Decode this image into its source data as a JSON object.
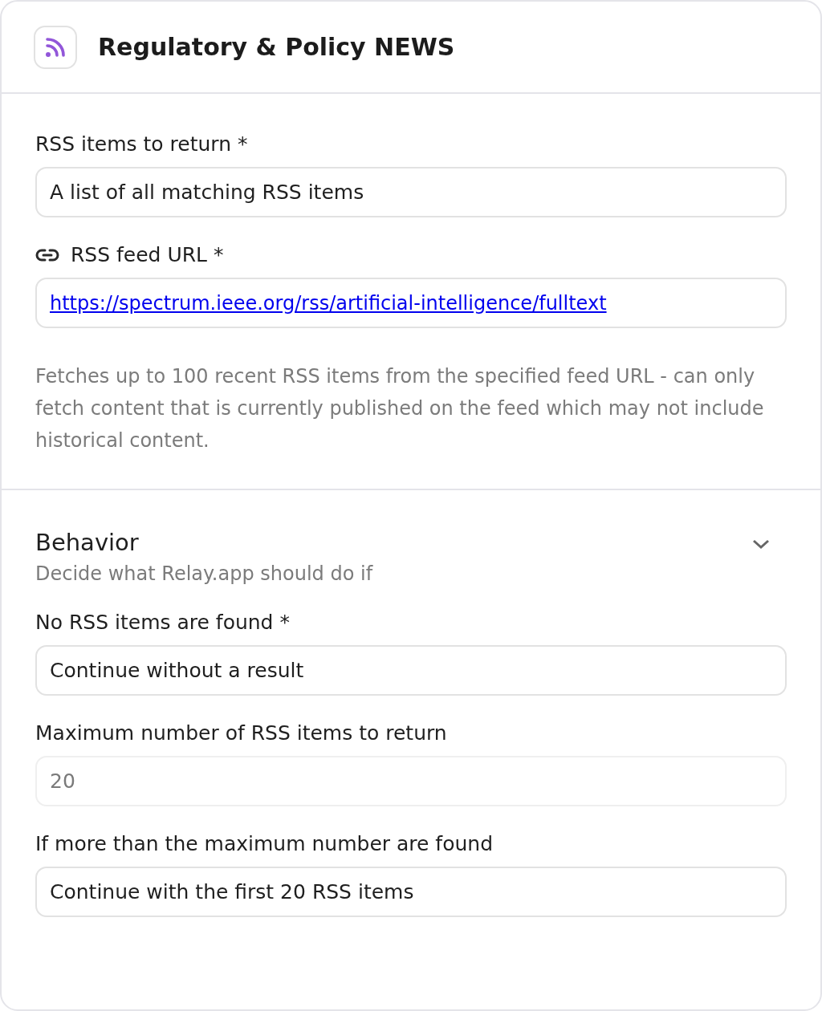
{
  "header": {
    "title": "Regulatory & Policy NEWS"
  },
  "input_fields": [
    {
      "kind": "select",
      "label": "RSS items to return *",
      "value": "A list of all matching RSS items"
    },
    {
      "kind": "url",
      "label": "RSS feed URL *",
      "value": "https://spectrum.ieee.org/rss/artificial-intelligence/fulltext"
    }
  ],
  "help_text": "Fetches up to 100 recent RSS items from the specified feed URL - can only fetch content that is currently published on the feed which may not include historical content.",
  "behavior": {
    "title": "Behavior",
    "subtitle": "Decide what Relay.app should do if",
    "expanded": true,
    "fields": [
      {
        "kind": "select",
        "label": "No RSS items are found *",
        "value": "Continue without a result"
      },
      {
        "kind": "number",
        "label": "Maximum number of RSS items to return",
        "placeholder": "20"
      },
      {
        "kind": "select",
        "label": "If more than the maximum number are found",
        "value": "Continue with the first 20 RSS items"
      }
    ]
  }
}
